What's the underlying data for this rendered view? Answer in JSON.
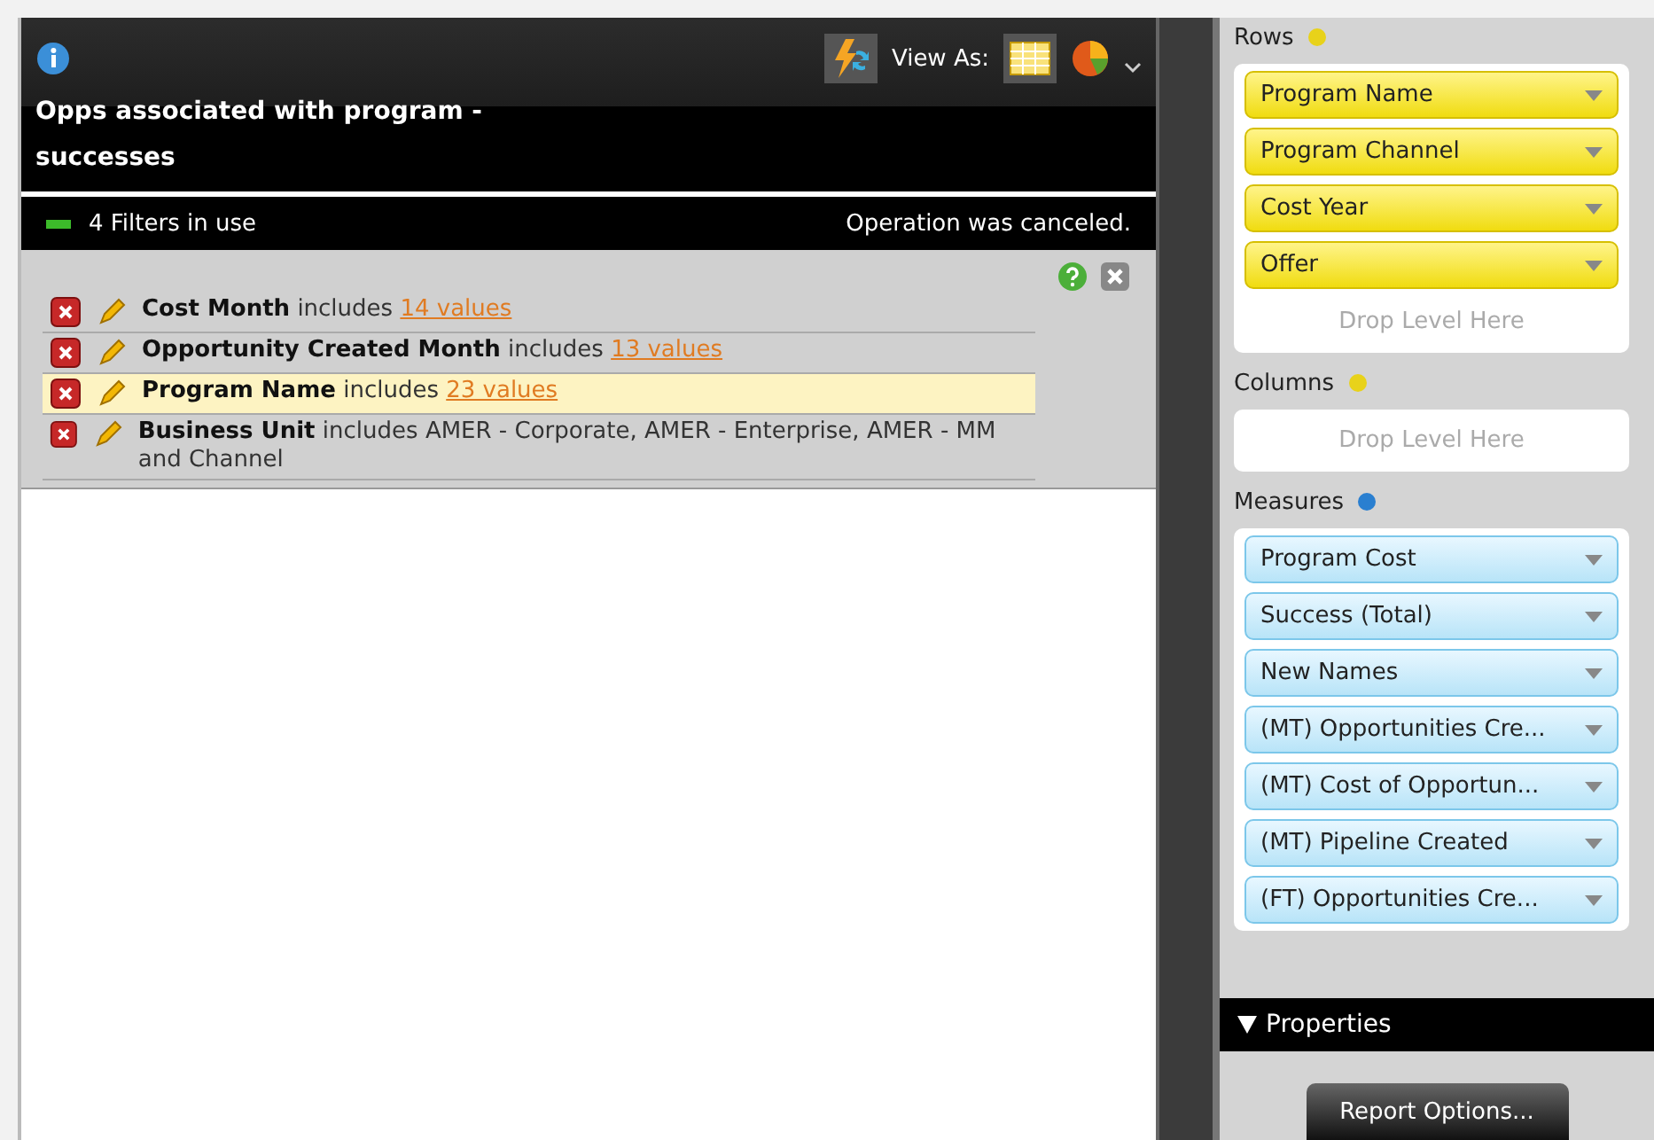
{
  "report": {
    "title": "Opps associated with program - successes",
    "view_as_label": "View As:"
  },
  "filter_bar": {
    "count_label": "4 Filters in use",
    "status": "Operation was canceled."
  },
  "filters": [
    {
      "field": "Cost Month",
      "verb": "includes",
      "values": "14 values",
      "kind": "link",
      "selected": false
    },
    {
      "field": "Opportunity Created Month",
      "verb": "includes",
      "values": "13 values",
      "kind": "link",
      "selected": false
    },
    {
      "field": "Program Name",
      "verb": "includes",
      "values": "23 values",
      "kind": "link",
      "selected": true
    },
    {
      "field": "Business Unit",
      "verb": "includes",
      "values": "AMER - Corporate, AMER - Enterprise, AMER - MM and Channel",
      "kind": "text",
      "selected": false
    }
  ],
  "zones": [
    {
      "title": "Rows",
      "color": "#e8d21a",
      "kind": "dimension",
      "items": [
        "Program Name",
        "Program Channel",
        "Cost Year",
        "Offer"
      ],
      "drop_hint": "Drop Level Here"
    },
    {
      "title": "Columns",
      "color": "#e8d21a",
      "drop_hint": "Drop Level Here"
    },
    {
      "title": "Measures",
      "color": "#2a7fd0",
      "kind": "measure",
      "items": [
        "Program Cost",
        "Success (Total)",
        "New Names",
        "(MT) Opportunities Cre...",
        "(MT) Cost of Opportun...",
        "(MT) Pipeline Created",
        "(FT) Opportunities Cre..."
      ]
    }
  ],
  "properties": {
    "title": "Properties",
    "button": "Report Options..."
  }
}
